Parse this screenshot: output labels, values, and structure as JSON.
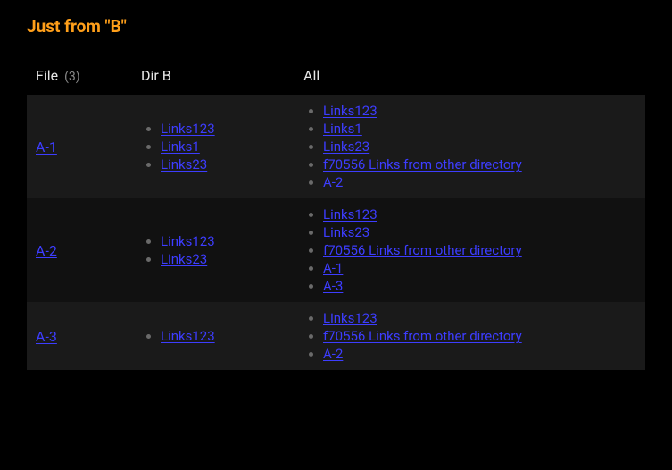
{
  "title": "Just from \"B\"",
  "columns": {
    "file": {
      "label": "File",
      "count": "(3)"
    },
    "dirb": {
      "label": "Dir B"
    },
    "all": {
      "label": "All"
    }
  },
  "rows": [
    {
      "file": "A-1",
      "dirb": [
        "Links123",
        "Links1",
        "Links23"
      ],
      "all": [
        "Links123",
        "Links1",
        "Links23",
        "f70556 Links from other directory",
        "A-2"
      ]
    },
    {
      "file": "A-2",
      "dirb": [
        "Links123",
        "Links23"
      ],
      "all": [
        "Links123",
        "Links23",
        "f70556 Links from other directory",
        "A-1",
        "A-3"
      ]
    },
    {
      "file": "A-3",
      "dirb": [
        "Links123"
      ],
      "all": [
        "Links123",
        "f70556 Links from other directory",
        "A-2"
      ]
    }
  ]
}
